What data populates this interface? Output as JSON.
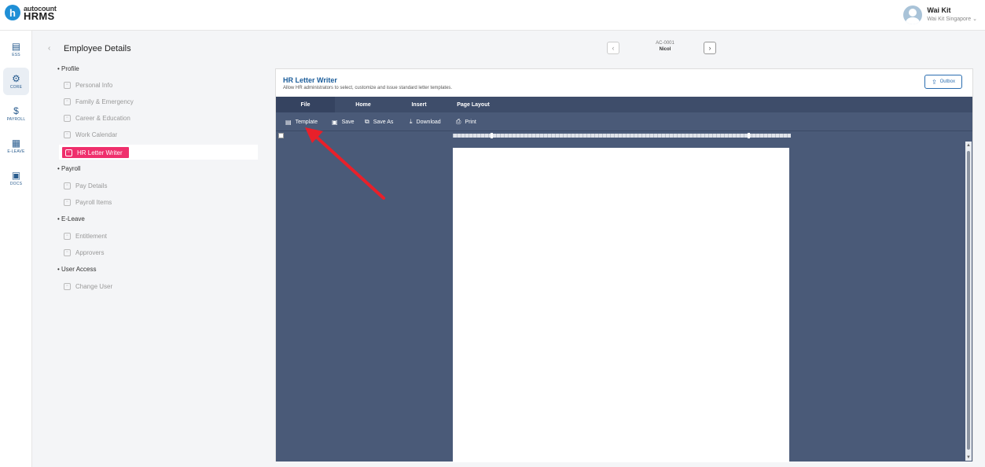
{
  "header": {
    "logo_brand": "autocount",
    "logo_product": "HRMS",
    "user_name": "Wai Kit",
    "user_company": "Wai Kit Singapore"
  },
  "leftnav": [
    {
      "icon": "▤",
      "label": "ESS"
    },
    {
      "icon": "⚙",
      "label": "CORE"
    },
    {
      "icon": "$",
      "label": "PAYROLL"
    },
    {
      "icon": "▦",
      "label": "E-LEAVE"
    },
    {
      "icon": "▣",
      "label": "DOCS"
    }
  ],
  "page_title": "Employee Details",
  "groups": {
    "profile": "Profile",
    "payroll": "Payroll",
    "eleave": "E-Leave",
    "useraccess": "User Access"
  },
  "menu": {
    "personal_info": "Personal Info",
    "family": "Family & Emergency",
    "career": "Career & Education",
    "work_calendar": "Work Calendar",
    "hr_letter_writer": "HR Letter Writer",
    "pay_details": "Pay Details",
    "payroll_items": "Payroll Items",
    "entitlement": "Entitlement",
    "approvers": "Approvers",
    "change_user": "Change User"
  },
  "employee": {
    "code": "AC-0001",
    "name": "Nicol"
  },
  "letter_writer": {
    "title": "HR Letter Writer",
    "description": "Allow HR administrators to select, customize and issue standard letter templates.",
    "outbox_label": "Outbox",
    "tabs": [
      "File",
      "Home",
      "Insert",
      "Page Layout"
    ],
    "tools": {
      "template": "Template",
      "save": "Save",
      "save_as": "Save As",
      "download": "Download",
      "print": "Print"
    }
  },
  "colors": {
    "accent": "#ef2f6c",
    "title_blue": "#1a5c9a",
    "editor_bg": "#4a5a78",
    "annotation_arrow": "#e8202a"
  }
}
